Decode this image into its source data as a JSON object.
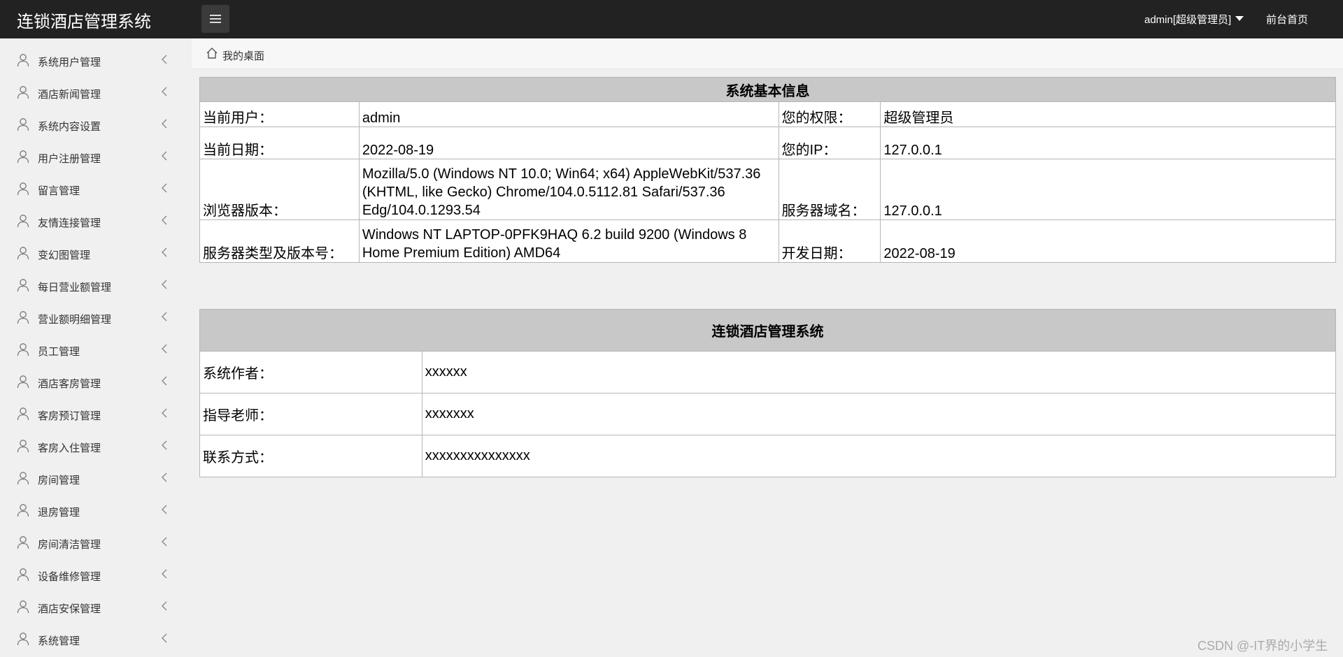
{
  "header": {
    "app_title": "连锁酒店管理系统",
    "user_label": "admin[超级管理员]",
    "front_link": "前台首页"
  },
  "sidebar": {
    "items": [
      {
        "label": "系统用户管理"
      },
      {
        "label": "酒店新闻管理"
      },
      {
        "label": "系统内容设置"
      },
      {
        "label": "用户注册管理"
      },
      {
        "label": "留言管理"
      },
      {
        "label": "友情连接管理"
      },
      {
        "label": "变幻图管理"
      },
      {
        "label": "每日营业额管理"
      },
      {
        "label": "营业额明细管理"
      },
      {
        "label": "员工管理"
      },
      {
        "label": "酒店客房管理"
      },
      {
        "label": "客房预订管理"
      },
      {
        "label": "客房入住管理"
      },
      {
        "label": "房间管理"
      },
      {
        "label": "退房管理"
      },
      {
        "label": "房间清洁管理"
      },
      {
        "label": "设备维修管理"
      },
      {
        "label": "酒店安保管理"
      },
      {
        "label": "系统管理"
      }
    ]
  },
  "breadcrumb": {
    "label": "我的桌面"
  },
  "system_info": {
    "heading": "系统基本信息",
    "rows": [
      {
        "label1": "当前用户：",
        "value1": "admin",
        "label2": "您的权限：",
        "value2": "超级管理员"
      },
      {
        "label1": "当前日期：",
        "value1": "2022-08-19",
        "label2": "您的IP：",
        "value2": "127.0.0.1"
      },
      {
        "label1": "浏览器版本：",
        "value1": "Mozilla/5.0 (Windows NT 10.0; Win64; x64) AppleWebKit/537.36 (KHTML, like Gecko) Chrome/104.0.5112.81 Safari/537.36 Edg/104.0.1293.54",
        "label2": "服务器域名：",
        "value2": "127.0.0.1"
      },
      {
        "label1": "服务器类型及版本号：",
        "value1": "Windows NT LAPTOP-0PFK9HAQ 6.2 build 9200 (Windows 8 Home Premium Edition) AMD64",
        "label2": "开发日期：",
        "value2": "2022-08-19"
      }
    ]
  },
  "about": {
    "heading": "连锁酒店管理系统",
    "rows": [
      {
        "label": "系统作者：",
        "value": "xxxxxx"
      },
      {
        "label": "指导老师：",
        "value": "xxxxxxx"
      },
      {
        "label": "联系方式：",
        "value": "xxxxxxxxxxxxxxx"
      }
    ]
  },
  "watermark": "CSDN @-IT界的小学生"
}
